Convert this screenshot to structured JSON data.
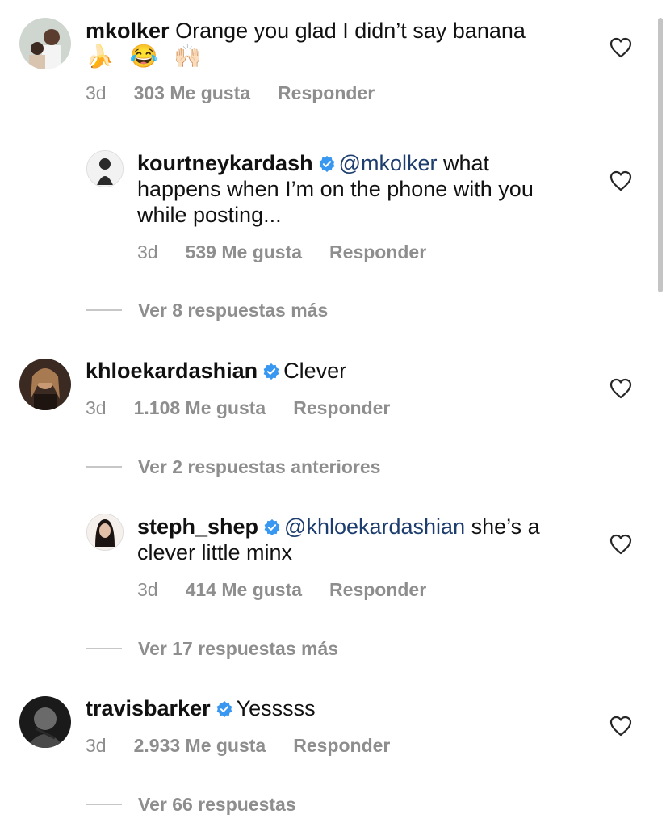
{
  "comments": [
    {
      "username": "mkolker",
      "verified": false,
      "text": "Orange you glad I didn’t say banana",
      "emoji": "🍌 😂 🙌🏻",
      "time": "3d",
      "likes": "303 Me gusta",
      "reply": "Responder"
    },
    {
      "username": "kourtneykardash",
      "verified": true,
      "mention": "@mkolker",
      "text": "what happens when I’m on the phone with you while posting...",
      "time": "3d",
      "likes": "539 Me gusta",
      "reply": "Responder"
    },
    {
      "view_more": "Ver 8 respuestas más"
    },
    {
      "username": "khloekardashian",
      "verified": true,
      "text": "Clever",
      "time": "3d",
      "likes": "1.108 Me gusta",
      "reply": "Responder"
    },
    {
      "view_more": "Ver 2 respuestas anteriores"
    },
    {
      "username": "steph_shep",
      "verified": true,
      "mention": "@khloekardashian",
      "text": "she’s a clever little minx",
      "time": "3d",
      "likes": "414 Me gusta",
      "reply": "Responder"
    },
    {
      "view_more": "Ver 17 respuestas más"
    },
    {
      "username": "travisbarker",
      "verified": true,
      "text": "Yesssss",
      "time": "3d",
      "likes": "2.933 Me gusta",
      "reply": "Responder"
    },
    {
      "view_more": "Ver 66 respuestas"
    }
  ],
  "colors": {
    "verified_badge": "#3897f0",
    "mention": "#1c3d6e",
    "meta_gray": "#8e8e8e"
  },
  "icons": {
    "verified": "verified-badge-icon",
    "like": "heart-outline-icon"
  }
}
